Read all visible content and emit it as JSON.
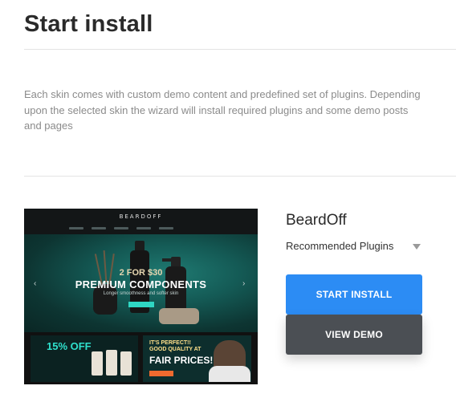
{
  "page": {
    "title": "Start install",
    "intro": "Each skin comes with custom demo content and predefined set of plugins. Depending upon the selected skin the wizard will install required plugins and some demo posts and pages"
  },
  "skin": {
    "name": "BeardOff",
    "plugins_label": "Recommended Plugins",
    "start_install_label": "START INSTALL",
    "view_demo_label": "VIEW DEMO",
    "preview": {
      "brand": "BEARDOFF",
      "hero_line1": "2 FOR $30",
      "hero_line2": "PREMIUM COMPONENTS",
      "hero_line3": "Longer smoothness and softer skin",
      "promo1": "15% OFF",
      "promo2_line1": "IT'S PERFECT!!",
      "promo2_line2": "GOOD QUALITY AT",
      "promo2_line3": "FAIR PRICES!"
    }
  },
  "colors": {
    "start_button": "#2c8cf4",
    "demo_button": "#4b4f54"
  }
}
